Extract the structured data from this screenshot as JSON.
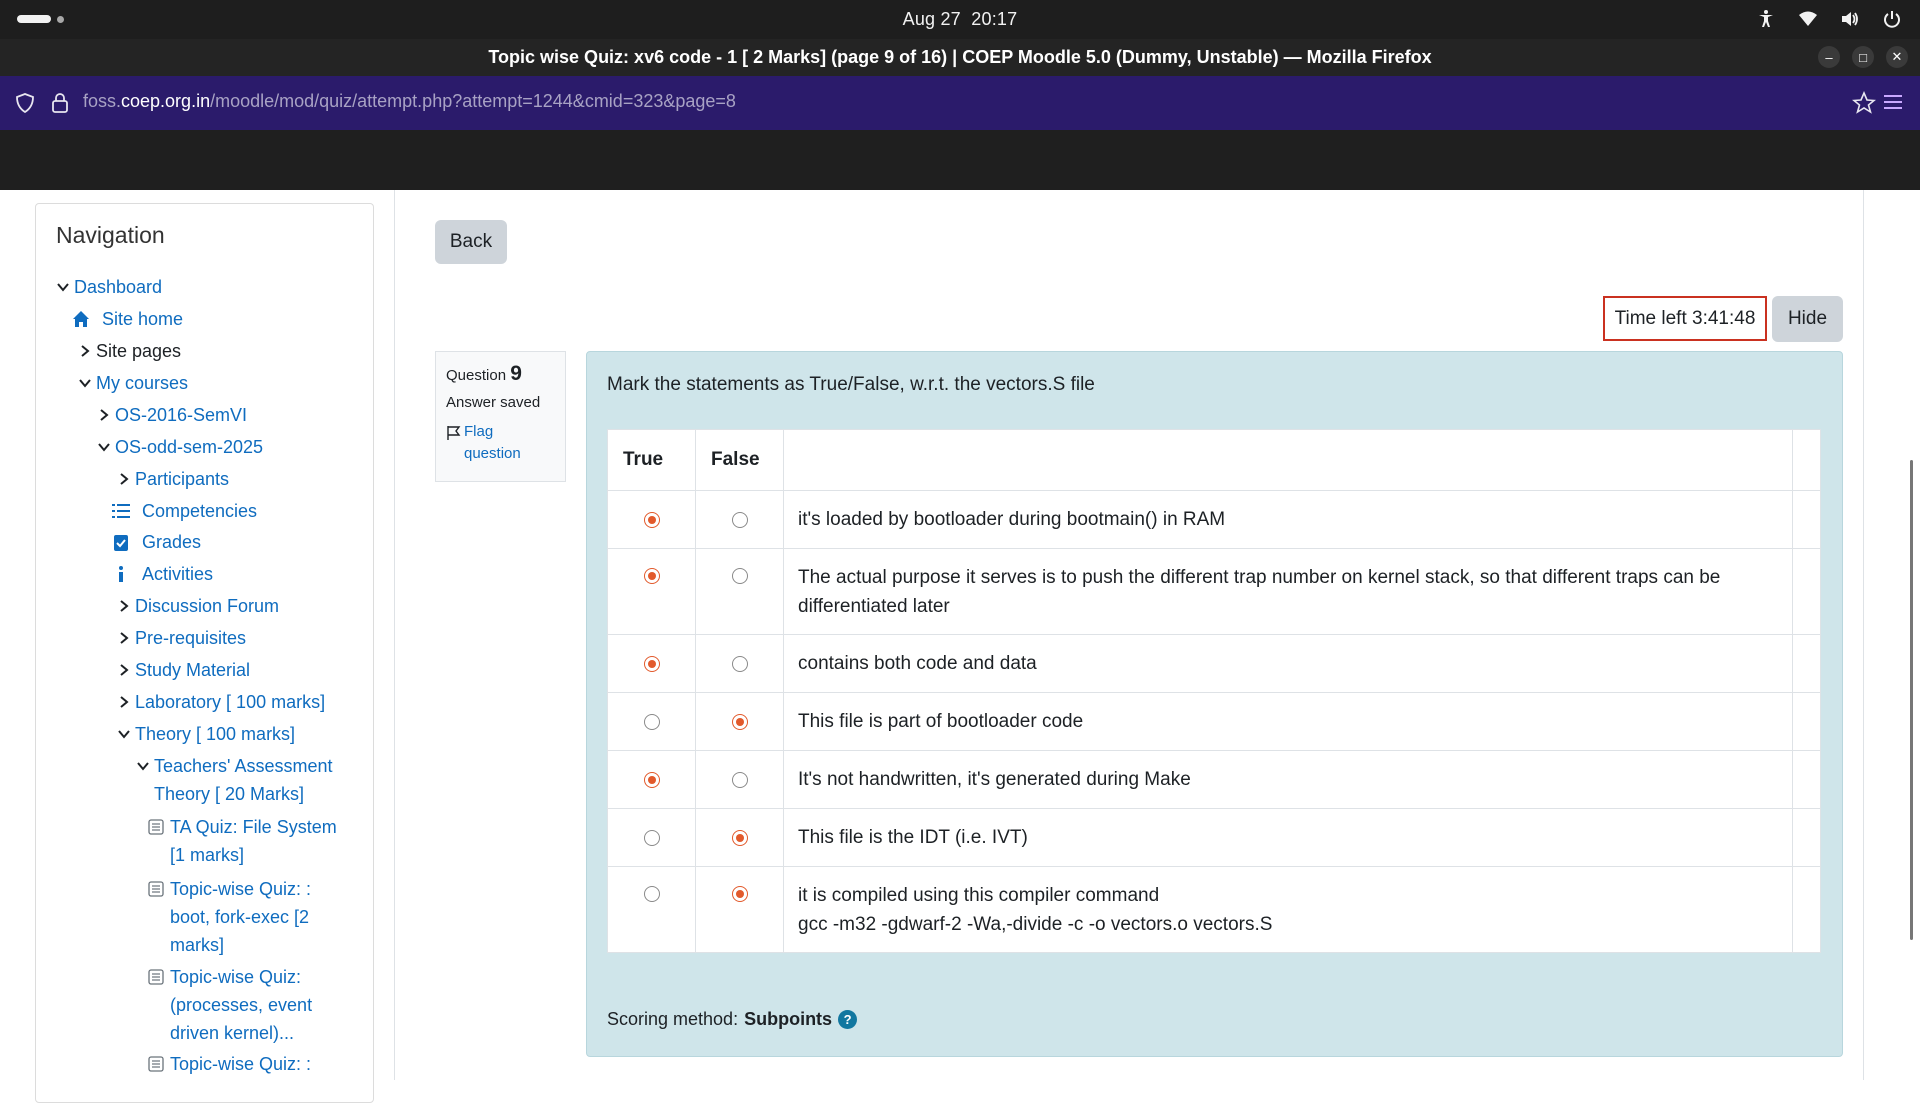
{
  "system_bar": {
    "date": "Aug 27",
    "time": "20:17"
  },
  "window": {
    "title": "Topic wise Quiz: xv6 code - 1 [ 2 Marks] (page 9 of 16) | COEP Moodle 5.0 (Dummy, Unstable) — Mozilla Firefox"
  },
  "browser": {
    "url_prefix": "foss.",
    "url_host": "coep.org.in",
    "url_path": "/moodle/mod/quiz/attempt.php?attempt=1244&cmid=323&page=8"
  },
  "navigation": {
    "title": "Navigation",
    "items": [
      {
        "label": "Dashboard",
        "chevron": "down",
        "icon": "",
        "link": true
      },
      {
        "label": "Site home",
        "chevron": "",
        "icon": "home-icon",
        "link": true
      },
      {
        "label": "Site pages",
        "chevron": "right",
        "icon": "",
        "link": false
      },
      {
        "label": "My courses",
        "chevron": "down",
        "icon": "",
        "link": true
      },
      {
        "label": "OS-2016-SemVI",
        "chevron": "right",
        "icon": "",
        "link": true
      },
      {
        "label": "OS-odd-sem-2025",
        "chevron": "down",
        "icon": "",
        "link": true
      },
      {
        "label": "Participants",
        "chevron": "right",
        "icon": "",
        "link": true
      },
      {
        "label": "Competencies",
        "chevron": "",
        "icon": "list-icon",
        "link": true
      },
      {
        "label": "Grades",
        "chevron": "",
        "icon": "clipboard-check-icon",
        "link": true
      },
      {
        "label": "Activities",
        "chevron": "",
        "icon": "info-icon",
        "link": true
      },
      {
        "label": "Discussion Forum",
        "chevron": "right",
        "icon": "",
        "link": true
      },
      {
        "label": "Pre-requisites",
        "chevron": "right",
        "icon": "",
        "link": true
      },
      {
        "label": "Study Material",
        "chevron": "right",
        "icon": "",
        "link": true
      },
      {
        "label": "Laboratory [ 100 marks]",
        "chevron": "right",
        "icon": "",
        "link": true
      },
      {
        "label": "Theory [ 100 marks]",
        "chevron": "down",
        "icon": "",
        "link": true
      },
      {
        "label_lines": [
          "Teachers' Assessment",
          "Theory [ 20 Marks]"
        ],
        "chevron": "down",
        "icon": "",
        "link": true
      },
      {
        "label_lines": [
          "TA Quiz: File System",
          "[1 marks]"
        ],
        "chevron": "",
        "icon": "quiz-icon",
        "link": true
      },
      {
        "label_lines": [
          "Topic-wise Quiz: :",
          "boot, fork-exec [2",
          "marks]"
        ],
        "chevron": "",
        "icon": "quiz-icon",
        "link": true
      },
      {
        "label_lines": [
          "Topic-wise Quiz:",
          "(processes, event",
          "driven kernel)..."
        ],
        "chevron": "",
        "icon": "quiz-icon",
        "link": true
      },
      {
        "label_lines": [
          "Topic-wise Quiz: :"
        ],
        "chevron": "",
        "icon": "quiz-icon",
        "link": true
      }
    ]
  },
  "quiz": {
    "back_label": "Back",
    "timer_label": "Time left 3:41:48",
    "hide_label": "Hide",
    "question": {
      "number_prefix": "Question",
      "number": "9",
      "state": "Answer saved",
      "flag_label_1": "Flag",
      "flag_label_2": "question",
      "text": "Mark the statements as True/False, w.r.t. the vectors.S file",
      "col_true": "True",
      "col_false": "False",
      "rows": [
        {
          "lines": [
            "it's loaded by bootloader during bootmain() in RAM"
          ],
          "selected": "true"
        },
        {
          "lines": [
            "The actual purpose it serves is to push the different trap number on kernel stack, so that different traps can be",
            "differentiated later"
          ],
          "selected": "true"
        },
        {
          "lines": [
            "contains both code and data"
          ],
          "selected": "true"
        },
        {
          "lines": [
            "This file is part of bootloader code"
          ],
          "selected": "false"
        },
        {
          "lines": [
            "It's not handwritten, it's generated during Make"
          ],
          "selected": "true"
        },
        {
          "lines": [
            "This file is the IDT (i.e. IVT)"
          ],
          "selected": "false"
        },
        {
          "lines": [
            "it is compiled using this compiler command",
            "gcc -m32 -gdwarf-2 -Wa,-divide   -c -o vectors.o vectors.S"
          ],
          "selected": "false"
        }
      ],
      "scoring_label": "Scoring method:",
      "scoring_value": "Subpoints",
      "help_symbol": "?"
    }
  },
  "colors": {
    "link": "#0f6cbf",
    "radio_selected": "#e25a2c",
    "question_bg": "#cfe5ea",
    "timer_border": "#ca3120",
    "url_bar_bg": "#2b1b6b"
  }
}
